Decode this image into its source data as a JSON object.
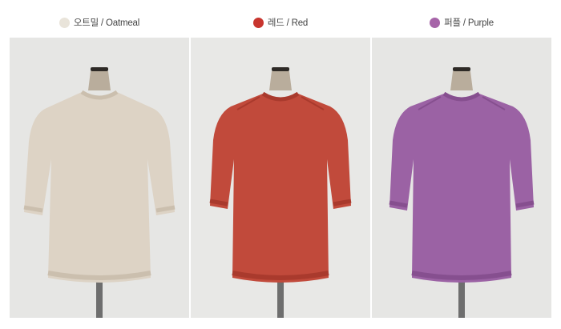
{
  "colors": [
    {
      "korean": "오트밀",
      "separator": "/",
      "english": "Oatmeal",
      "swatch_color": "#e9e4da",
      "garment_color": "#ddd3c5",
      "garment_shade": "#cbbfae",
      "background": "#e6e6e4"
    },
    {
      "korean": "레드",
      "separator": "/",
      "english": "Red",
      "swatch_color": "#c8352e",
      "garment_color": "#c14a3b",
      "garment_shade": "#a93a2d",
      "background": "#e8e8e6"
    },
    {
      "korean": "퍼플",
      "separator": "/",
      "english": "Purple",
      "swatch_color": "#a664a8",
      "garment_color": "#9b62a4",
      "garment_shade": "#864f8f",
      "background": "#e6e6e4"
    }
  ]
}
